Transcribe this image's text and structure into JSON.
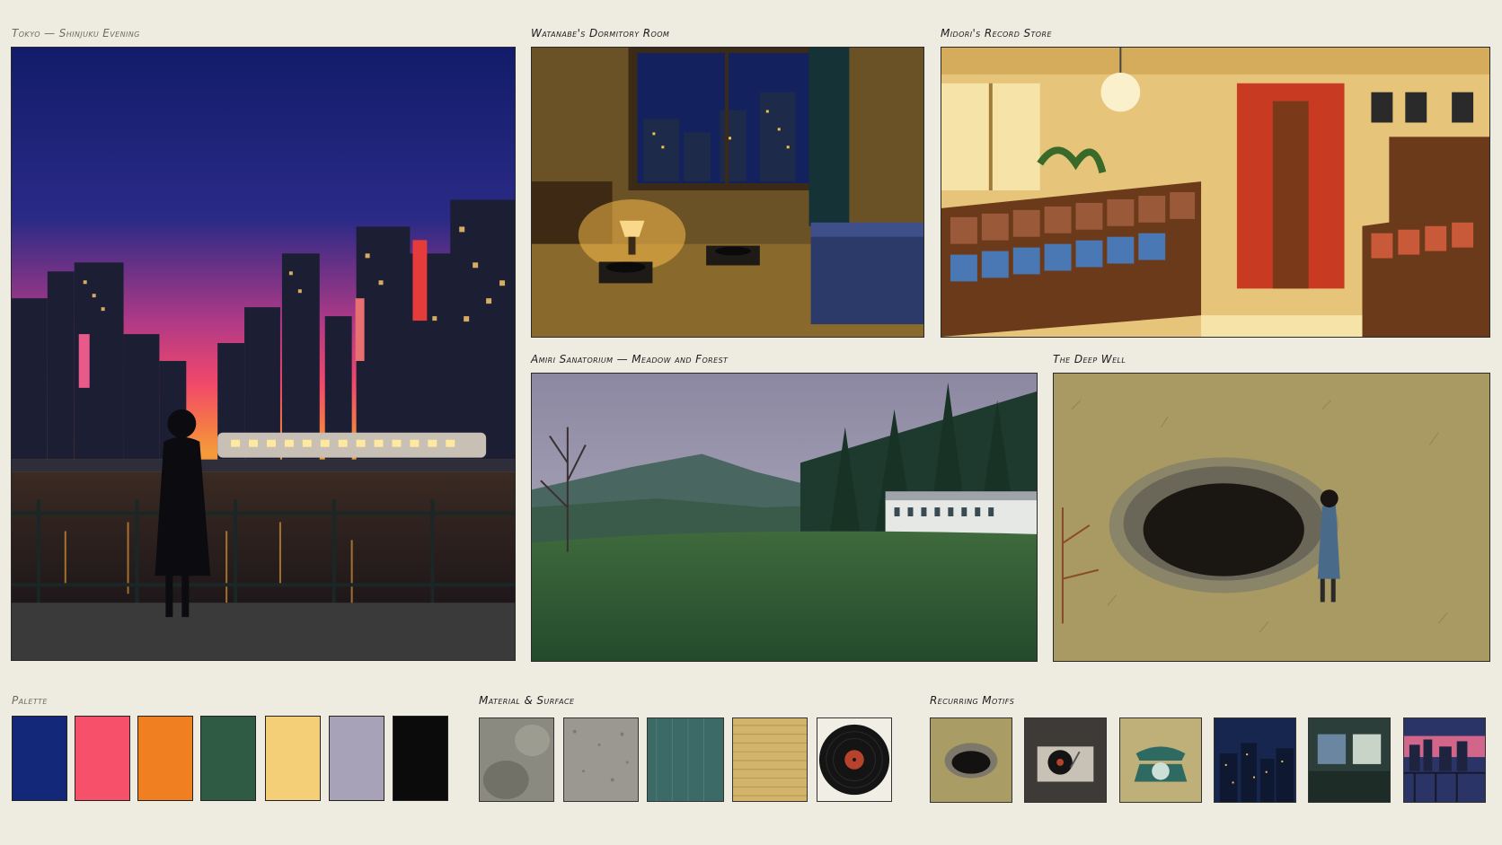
{
  "panels": {
    "tokyo": "Tokyo — Shinjuku Evening",
    "dorm": "Watanabe's Dormitory Room",
    "store": "Midori's Record Store",
    "sanatorium": "Amiri Sanatorium — Meadow and Forest",
    "well": "The Deep Well"
  },
  "sections": {
    "palette": "Palette",
    "material": "Material & Surface",
    "motifs": "Recurring Motifs"
  },
  "palette_colors": [
    "#14287a",
    "#f7506a",
    "#f07f22",
    "#2f5a44",
    "#f5cf78",
    "#a8a2b8",
    "#0b0b0b"
  ],
  "materials": [
    "mist-texture",
    "concrete-texture",
    "teal-rain-texture",
    "tatami-texture",
    "vinyl-record"
  ],
  "motifs": [
    "well-icon",
    "turntable-icon",
    "rotary-phone-icon",
    "night-city-icon",
    "train-window-icon",
    "skyline-balcony-icon"
  ]
}
